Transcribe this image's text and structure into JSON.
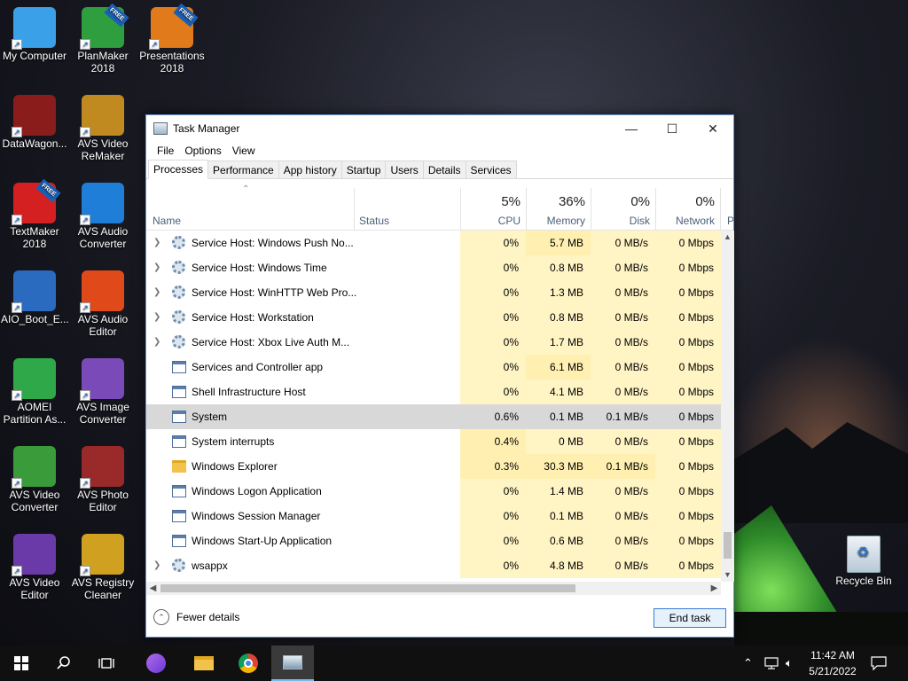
{
  "desktop": {
    "icons_left": [
      {
        "label": "My Computer",
        "color": "#3aa0e8"
      },
      {
        "label": "DataWagon...",
        "color": "#8a1c1c"
      },
      {
        "label": "TextMaker 2018",
        "color": "#d42020"
      },
      {
        "label": "AIO_Boot_E...",
        "color": "#2a6abf"
      },
      {
        "label": "AOMEI Partition As...",
        "color": "#2fa84a"
      },
      {
        "label": "AVS Video Converter",
        "color": "#3a9b3a"
      },
      {
        "label": "AVS Video Editor",
        "color": "#6a3aa8"
      }
    ],
    "icons_mid": [
      {
        "label": "PlanMaker 2018",
        "color": "#2e9e3e"
      },
      {
        "label": "AVS Video ReMaker",
        "color": "#c08a20"
      },
      {
        "label": "AVS Audio Converter",
        "color": "#1f7ed8"
      },
      {
        "label": "AVS Audio Editor",
        "color": "#e04a1a"
      },
      {
        "label": "AVS Image Converter",
        "color": "#7a4ab8"
      },
      {
        "label": "AVS Photo Editor",
        "color": "#9a2a2a"
      },
      {
        "label": "AVS Registry Cleaner",
        "color": "#d0a020"
      }
    ],
    "icon_presentations": {
      "label": "Presentations 2018",
      "color": "#e07a1a"
    },
    "recycle_bin": "Recycle Bin",
    "free_badge": "FREE"
  },
  "window": {
    "title": "Task Manager",
    "min": "—",
    "max": "☐",
    "close": "✕",
    "menu": [
      "File",
      "Options",
      "View"
    ],
    "tabs": [
      "Processes",
      "Performance",
      "App history",
      "Startup",
      "Users",
      "Details",
      "Services"
    ],
    "active_tab": "Processes",
    "columns": {
      "name": "Name",
      "status": "Status",
      "cpu": {
        "pct": "5%",
        "label": "CPU"
      },
      "memory": {
        "pct": "36%",
        "label": "Memory"
      },
      "disk": {
        "pct": "0%",
        "label": "Disk"
      },
      "network": {
        "pct": "0%",
        "label": "Network"
      },
      "power": "P"
    },
    "processes": [
      {
        "name": "Service Host: Windows Push No...",
        "icon": "gear-icon",
        "expand": true,
        "cpu": "0%",
        "memory": "5.7 MB",
        "disk": "0 MB/s",
        "network": "0 Mbps"
      },
      {
        "name": "Service Host: Windows Time",
        "icon": "gear-icon",
        "expand": true,
        "cpu": "0%",
        "memory": "0.8 MB",
        "disk": "0 MB/s",
        "network": "0 Mbps"
      },
      {
        "name": "Service Host: WinHTTP Web Pro...",
        "icon": "gear-icon",
        "expand": true,
        "cpu": "0%",
        "memory": "1.3 MB",
        "disk": "0 MB/s",
        "network": "0 Mbps"
      },
      {
        "name": "Service Host: Workstation",
        "icon": "gear-icon",
        "expand": true,
        "cpu": "0%",
        "memory": "0.8 MB",
        "disk": "0 MB/s",
        "network": "0 Mbps"
      },
      {
        "name": "Service Host: Xbox Live Auth M...",
        "icon": "gear-icon",
        "expand": true,
        "cpu": "0%",
        "memory": "1.7 MB",
        "disk": "0 MB/s",
        "network": "0 Mbps"
      },
      {
        "name": "Services and Controller app",
        "icon": "window-icon",
        "expand": false,
        "cpu": "0%",
        "memory": "6.1 MB",
        "disk": "0 MB/s",
        "network": "0 Mbps"
      },
      {
        "name": "Shell Infrastructure Host",
        "icon": "window-icon",
        "expand": false,
        "cpu": "0%",
        "memory": "4.1 MB",
        "disk": "0 MB/s",
        "network": "0 Mbps"
      },
      {
        "name": "System",
        "icon": "window-icon",
        "expand": false,
        "selected": true,
        "cpu": "0.6%",
        "memory": "0.1 MB",
        "disk": "0.1 MB/s",
        "network": "0 Mbps"
      },
      {
        "name": "System interrupts",
        "icon": "window-icon",
        "expand": false,
        "cpu": "0.4%",
        "memory": "0 MB",
        "disk": "0 MB/s",
        "network": "0 Mbps"
      },
      {
        "name": "Windows Explorer",
        "icon": "folder-icon",
        "expand": false,
        "cpu": "0.3%",
        "memory": "30.3 MB",
        "disk": "0.1 MB/s",
        "network": "0 Mbps"
      },
      {
        "name": "Windows Logon Application",
        "icon": "window-icon",
        "expand": false,
        "cpu": "0%",
        "memory": "1.4 MB",
        "disk": "0 MB/s",
        "network": "0 Mbps"
      },
      {
        "name": "Windows Session Manager",
        "icon": "window-icon",
        "expand": false,
        "cpu": "0%",
        "memory": "0.1 MB",
        "disk": "0 MB/s",
        "network": "0 Mbps"
      },
      {
        "name": "Windows Start-Up Application",
        "icon": "window-icon",
        "expand": false,
        "cpu": "0%",
        "memory": "0.6 MB",
        "disk": "0 MB/s",
        "network": "0 Mbps"
      },
      {
        "name": "wsappx",
        "icon": "gear-icon",
        "expand": true,
        "cpu": "0%",
        "memory": "4.8 MB",
        "disk": "0 MB/s",
        "network": "0 Mbps"
      }
    ],
    "fewer_details": "Fewer details",
    "end_task": "End task"
  },
  "taskbar": {
    "time": "11:42 AM",
    "date": "5/21/2022",
    "accent": "#76b9ed"
  }
}
